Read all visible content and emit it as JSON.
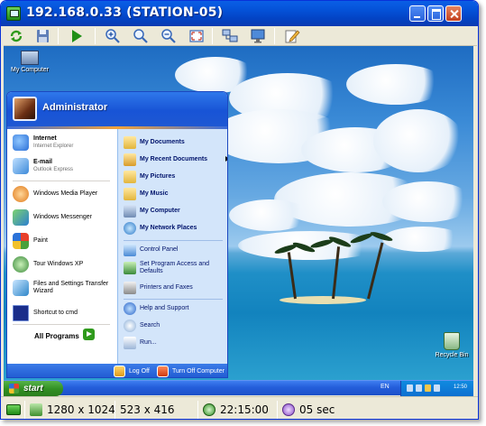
{
  "window": {
    "title": "192.168.0.33 (STATION-05)",
    "titlebar_color": "#0450d6",
    "buttons": [
      "minimize",
      "maximize",
      "close"
    ]
  },
  "toolbar": {
    "tools": [
      {
        "name": "refresh-icon"
      },
      {
        "name": "save-icon"
      },
      {
        "name": "play-icon"
      },
      {
        "name": "zoom-in-icon"
      },
      {
        "name": "zoom-icon"
      },
      {
        "name": "zoom-out-icon"
      },
      {
        "name": "fit-screen-icon"
      },
      {
        "name": "network-icon"
      },
      {
        "name": "monitor-icon"
      },
      {
        "name": "edit-icon"
      }
    ]
  },
  "desktop": {
    "icons": {
      "my_computer": "My Computer",
      "recycle_bin": "Recycle Bin"
    }
  },
  "start_menu": {
    "user": "Administrator",
    "pinned": [
      {
        "title": "Internet",
        "subtitle": "Internet Explorer",
        "icon": "internet-explorer-icon",
        "color": "#2a6fd6"
      },
      {
        "title": "E-mail",
        "subtitle": "Outlook Express",
        "icon": "email-icon",
        "color": "#3d8ad9"
      }
    ],
    "recent": [
      {
        "title": "Windows Media Player",
        "icon": "media-player-icon",
        "color": "#e07a1a"
      },
      {
        "title": "Windows Messenger",
        "icon": "messenger-icon",
        "color": "#3aa33a"
      },
      {
        "title": "Paint",
        "icon": "paint-icon",
        "color": "#c84a9b"
      },
      {
        "title": "Tour Windows XP",
        "icon": "tour-icon",
        "color": "#3a8a3a"
      },
      {
        "title": "Files and Settings Transfer",
        "subtitle": "Wizard",
        "icon": "transfer-wizard-icon",
        "color": "#2e86c9"
      },
      {
        "title": "Shortcut to cmd",
        "icon": "command-prompt-icon",
        "color": "#1a2d8a"
      }
    ],
    "all_programs": "All Programs",
    "places": [
      {
        "label": "My Documents",
        "icon": "my-documents-icon",
        "bold": true
      },
      {
        "label": "My Recent Documents",
        "icon": "recent-documents-icon",
        "bold": true,
        "submenu": true
      },
      {
        "label": "My Pictures",
        "icon": "my-pictures-icon",
        "bold": true
      },
      {
        "label": "My Music",
        "icon": "my-music-icon",
        "bold": true
      },
      {
        "label": "My Computer",
        "icon": "my-computer-icon",
        "bold": true
      },
      {
        "label": "My Network Places",
        "icon": "network-places-icon",
        "bold": true
      }
    ],
    "system": [
      {
        "label": "Control Panel",
        "icon": "control-panel-icon"
      },
      {
        "label": "Set Program Access and Defaults",
        "icon": "program-access-icon"
      },
      {
        "label": "Printers and Faxes",
        "icon": "printers-icon"
      }
    ],
    "help": [
      {
        "label": "Help and Support",
        "icon": "help-icon"
      },
      {
        "label": "Search",
        "icon": "search-icon"
      },
      {
        "label": "Run...",
        "icon": "run-icon"
      }
    ],
    "footer": {
      "log_off": "Log Off",
      "turn_off": "Turn Off Computer"
    }
  },
  "taskbar": {
    "start": "start",
    "language": "EN",
    "clock": "12:50"
  },
  "statusbar": {
    "screen_resolution": "1280 x 1024",
    "view_size": "523 x 416",
    "session_time": "22:15:00",
    "refresh_interval": "05 sec"
  }
}
